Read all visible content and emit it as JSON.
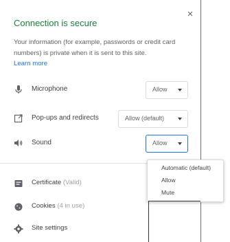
{
  "dialog": {
    "title": "Connection is secure",
    "info": "Your information (for example, passwords or credit card numbers) is private when it is sent to this site.",
    "learn_more": "Learn more",
    "close": "×"
  },
  "permissions": [
    {
      "label": "Microphone",
      "value": "Allow",
      "icon": "microphone-icon"
    },
    {
      "label": "Pop-ups and redirects",
      "value": "Allow (default)",
      "icon": "popup-icon"
    },
    {
      "label": "Sound",
      "value": "Allow",
      "icon": "speaker-icon"
    }
  ],
  "sound_menu": {
    "options": [
      "Automatic (default)",
      "Allow",
      "Mute"
    ]
  },
  "footer": {
    "certificate": {
      "label": "Certificate",
      "sub": "(Valid)"
    },
    "cookies": {
      "label": "Cookies",
      "sub": "(4 in use)"
    },
    "site_settings": {
      "label": "Site settings"
    }
  },
  "colors": {
    "accent_green": "#188038",
    "link_blue": "#1a73e8"
  }
}
